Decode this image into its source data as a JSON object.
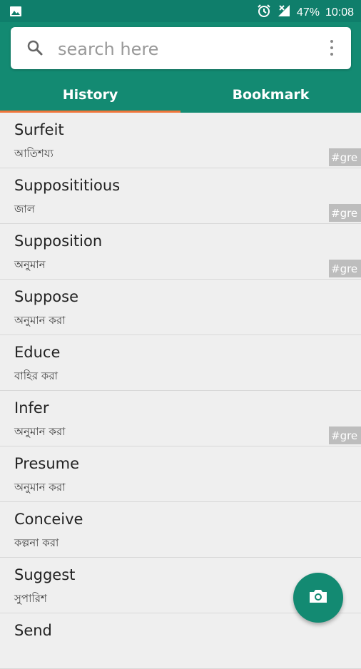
{
  "status_bar": {
    "battery": "47%",
    "time": "10:08",
    "icons": [
      "image-icon",
      "alarm-icon",
      "signal-icon"
    ]
  },
  "search": {
    "placeholder": "search here"
  },
  "tabs": [
    {
      "label": "History",
      "selected": true
    },
    {
      "label": "Bookmark",
      "selected": false
    }
  ],
  "colors": {
    "primary": "#138a72",
    "status_bar": "#0f7e6b",
    "tab_indicator": "#f0753a",
    "tag_bg": "#bdbdbd",
    "list_bg": "#efefef"
  },
  "entries": [
    {
      "word": "Surfeit",
      "meaning": "আতিশয্য",
      "tag": "#gre"
    },
    {
      "word": "Supposititious",
      "meaning": "জাল",
      "tag": "#gre"
    },
    {
      "word": "Supposition",
      "meaning": "অনুমান",
      "tag": "#gre"
    },
    {
      "word": "Suppose",
      "meaning": "অনুমান করা",
      "tag": ""
    },
    {
      "word": "Educe",
      "meaning": "বাহির করা",
      "tag": ""
    },
    {
      "word": "Infer",
      "meaning": "অনুমান করা",
      "tag": "#gre"
    },
    {
      "word": "Presume",
      "meaning": "অনুমান করা",
      "tag": ""
    },
    {
      "word": "Conceive",
      "meaning": "কল্পনা করা",
      "tag": ""
    },
    {
      "word": "Suggest",
      "meaning": "সুপারিশ",
      "tag": ""
    },
    {
      "word": "Send",
      "meaning": "",
      "tag": ""
    }
  ],
  "fab": {
    "icon": "camera-icon"
  }
}
